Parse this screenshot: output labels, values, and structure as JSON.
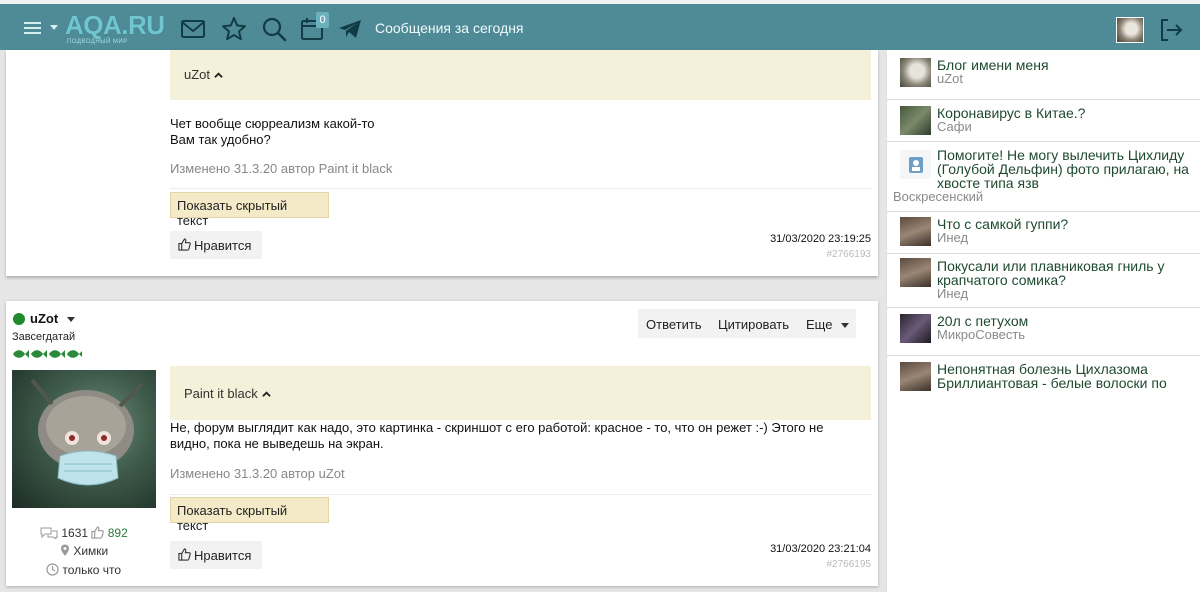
{
  "header": {
    "logo_text": "AQA.RU",
    "logo_subtitle": "ПОДВОДНЫЙ МИР",
    "notification_count": "0",
    "title": "Сообщения за сегодня",
    "icons": [
      "menu-icon",
      "mail-icon",
      "star-icon",
      "search-icon",
      "calendar-icon",
      "telegram-icon",
      "logout-icon"
    ],
    "accent_color": "#4f8a97"
  },
  "posts": [
    {
      "quote_author": "uZot",
      "text_lines": [
        "Чет вообще сюрреализм какой-то",
        "Вам так удобно?"
      ],
      "edited": "Изменено 31.3.20 автор Paint it black",
      "spoiler_label": "Показать скрытый текст",
      "like_label": "Нравится",
      "datetime": "31/03/2020 23:19:25",
      "post_id": "#2766193"
    },
    {
      "author": {
        "name": "uZot",
        "rank": "Завсегдатай",
        "posts_count": "1631",
        "likes_count": "892",
        "city": "Химки",
        "last_seen": "только что"
      },
      "actions": {
        "reply": "Ответить",
        "quote": "Цитировать",
        "more": "Еще"
      },
      "quote_author": "Paint it black",
      "text_lines": [
        "Не, форум выглядит как надо, это картинка - скриншот с его работой: красное - то, что он режет :-) Этого не",
        "видно, пока не выведешь на экран."
      ],
      "edited": "Изменено 31.3.20 автор uZot",
      "spoiler_label": "Показать скрытый текст",
      "like_label": "Нравится",
      "datetime": "31/03/2020 23:21:04",
      "post_id": "#2766195"
    }
  ],
  "sidebar": {
    "items": [
      {
        "title_lines": [
          "Блог имени меня"
        ],
        "author": "uZot"
      },
      {
        "title_lines": [
          "Коронавирус в Китае.?"
        ],
        "author": "Сафи"
      },
      {
        "title_lines": [
          "Помогите! Не могу вылечить Цихлиду",
          "(Голубой Дельфин) фото прилагаю, на",
          "хвосте типа язв"
        ],
        "author": "Воскресенский"
      },
      {
        "title_lines": [
          "Что с самкой гуппи?"
        ],
        "author": "Инед"
      },
      {
        "title_lines": [
          "Покусали или плавниковая гниль у",
          "крапчатого сомика?"
        ],
        "author": "Инед"
      },
      {
        "title_lines": [
          "20л с петухом"
        ],
        "author": "МикроСовесть"
      },
      {
        "title_lines": [
          "Непонятная болезнь Цихлазома",
          "Бриллиантовая - белые волоски по"
        ],
        "author": ""
      }
    ]
  }
}
